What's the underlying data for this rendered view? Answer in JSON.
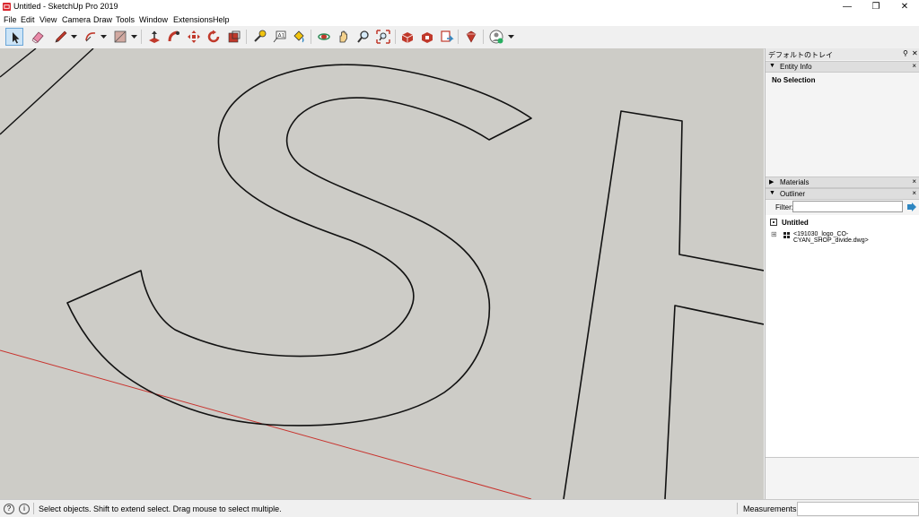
{
  "window": {
    "title": "Untitled - SketchUp Pro 2019"
  },
  "menu": [
    "File",
    "Edit",
    "View",
    "Camera",
    "Draw",
    "Tools",
    "Window",
    "Extensions",
    "Help"
  ],
  "toolbar_icons": [
    "select-icon",
    "eraser-icon",
    "pencil-icon",
    "arc-icon",
    "shape-icon",
    "push-pull-icon",
    "follow-me-icon",
    "move-icon",
    "rotate-icon",
    "scale-icon",
    "tape-measure-icon",
    "text-icon",
    "paint-bucket-icon",
    "orbit-icon",
    "pan-icon",
    "zoom-icon",
    "zoom-extents-icon",
    "3d-warehouse-icon",
    "extension-warehouse-icon",
    "layout-icon",
    "ruby-icon",
    "account-icon"
  ],
  "tray": {
    "title": "デフォルトのトレイ",
    "entity_info": {
      "label": "Entity Info",
      "selection": "No Selection"
    },
    "materials": {
      "label": "Materials"
    },
    "outliner": {
      "label": "Outliner",
      "filter_label": "Filter:",
      "filter_value": "",
      "root": "Untitled",
      "item": "<191030_logo_CO-CYAN_SHOP_divide.dwg>"
    }
  },
  "status": {
    "message": "Select objects. Shift to extend select. Drag mouse to select multiple.",
    "measurements_label": "Measurements",
    "measurements_value": ""
  },
  "colors": {
    "viewport_bg": "#cdccc7",
    "axis_red": "#c8322d",
    "selected_tool": "#cce4f7"
  }
}
